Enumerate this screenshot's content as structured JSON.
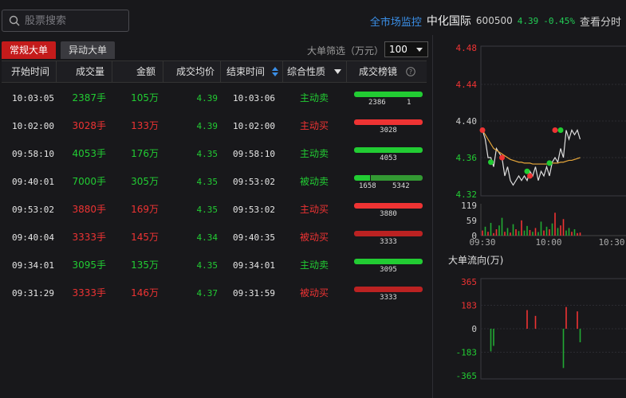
{
  "search": {
    "placeholder": "股票搜索"
  },
  "header": {
    "market_monitor": "全市场监控",
    "stock_name": "中化国际",
    "stock_code": "600500",
    "price": "4.39",
    "change": "-0.45%",
    "timeframe": "查看分时"
  },
  "tabs": [
    {
      "label": "常规大单",
      "active": true
    },
    {
      "label": "异动大单",
      "active": false
    }
  ],
  "filter": {
    "label": "大单筛选（万元）",
    "value": "100"
  },
  "table": {
    "columns": [
      "开始时间",
      "成交量",
      "金额",
      "成交均价",
      "结束时间",
      "综合性质",
      "成交榜镜"
    ],
    "rows": [
      {
        "start": "10:03:05",
        "volume": "2387手",
        "amount": "105万",
        "avg": "4.39",
        "end": "10:03:06",
        "nature": "主动卖",
        "color": "green",
        "bar": [
          {
            "v": "2386",
            "c": "#22cc33"
          },
          {
            "v": "1",
            "c": "#8a9a8a"
          }
        ]
      },
      {
        "start": "10:02:00",
        "volume": "3028手",
        "amount": "133万",
        "avg": "4.39",
        "end": "10:02:00",
        "nature": "主动买",
        "color": "red",
        "bar": [
          {
            "v": "3028",
            "c": "#ee3333"
          }
        ]
      },
      {
        "start": "09:58:10",
        "volume": "4053手",
        "amount": "176万",
        "avg": "4.35",
        "end": "09:58:10",
        "nature": "主动卖",
        "color": "green",
        "bar": [
          {
            "v": "4053",
            "c": "#22cc33"
          }
        ]
      },
      {
        "start": "09:40:01",
        "volume": "7000手",
        "amount": "305万",
        "avg": "4.35",
        "end": "09:53:02",
        "nature": "被动卖",
        "color": "green",
        "bar": [
          {
            "v": "1658",
            "c": "#22cc33"
          },
          {
            "v": "5342",
            "c": "#339933"
          }
        ]
      },
      {
        "start": "09:53:02",
        "volume": "3880手",
        "amount": "169万",
        "avg": "4.35",
        "end": "09:53:02",
        "nature": "主动买",
        "color": "red",
        "bar": [
          {
            "v": "3880",
            "c": "#ee3333"
          }
        ]
      },
      {
        "start": "09:40:04",
        "volume": "3333手",
        "amount": "145万",
        "avg": "4.34",
        "end": "09:40:35",
        "nature": "被动买",
        "color": "red",
        "bar": [
          {
            "v": "3333",
            "c": "#bb2222"
          }
        ]
      },
      {
        "start": "09:34:01",
        "volume": "3095手",
        "amount": "135万",
        "avg": "4.35",
        "end": "09:34:01",
        "nature": "主动卖",
        "color": "green",
        "bar": [
          {
            "v": "3095",
            "c": "#22cc33"
          }
        ]
      },
      {
        "start": "09:31:29",
        "volume": "3333手",
        "amount": "146万",
        "avg": "4.37",
        "end": "09:31:59",
        "nature": "被动买",
        "color": "red",
        "bar": [
          {
            "v": "3333",
            "c": "#bb2222"
          }
        ]
      }
    ]
  },
  "chart_data": [
    {
      "type": "line",
      "title": "",
      "y_ticks": [
        "4.48",
        "4.44",
        "4.40",
        "4.36",
        "4.32"
      ],
      "ylim": [
        4.32,
        4.48
      ],
      "x": [
        0,
        1,
        2,
        3,
        4,
        5,
        6,
        7,
        8,
        9,
        10,
        11,
        12,
        13,
        14,
        15,
        16,
        17,
        18,
        19,
        20,
        21,
        22,
        23,
        24,
        25,
        26,
        27,
        28,
        29,
        30,
        31,
        32,
        33,
        34,
        35
      ],
      "series": [
        {
          "color": "#e0e0e0",
          "values": [
            4.39,
            4.38,
            4.36,
            4.36,
            4.35,
            4.37,
            4.365,
            4.36,
            4.34,
            4.35,
            4.335,
            4.33,
            4.335,
            4.34,
            4.335,
            4.34,
            4.335,
            4.345,
            4.34,
            4.35,
            4.335,
            4.345,
            4.34,
            4.35,
            4.34,
            4.355,
            4.36,
            4.355,
            4.37,
            4.36,
            4.39,
            4.38,
            4.39,
            4.385,
            4.39,
            4.38
          ]
        },
        {
          "color": "#e6a63a",
          "values": [
            4.39,
            4.385,
            4.38,
            4.375,
            4.37,
            4.368,
            4.366,
            4.364,
            4.362,
            4.36,
            4.358,
            4.357,
            4.356,
            4.355,
            4.355,
            4.354,
            4.354,
            4.354,
            4.353,
            4.353,
            4.353,
            4.353,
            4.353,
            4.353,
            4.353,
            4.354,
            4.354,
            4.354,
            4.355,
            4.355,
            4.356,
            4.357,
            4.357,
            4.358,
            4.359,
            4.36
          ]
        }
      ],
      "markers": [
        {
          "x": 0,
          "y": 4.39,
          "c": "#ee3333"
        },
        {
          "x": 3,
          "y": 4.355,
          "c": "#22cc33"
        },
        {
          "x": 7,
          "y": 4.36,
          "c": "#ee3333"
        },
        {
          "x": 16,
          "y": 4.345,
          "c": "#22cc33"
        },
        {
          "x": 17,
          "y": 4.34,
          "c": "#ee3333"
        },
        {
          "x": 24,
          "y": 4.354,
          "c": "#22cc33"
        },
        {
          "x": 26,
          "y": 4.39,
          "c": "#ee3333"
        },
        {
          "x": 28,
          "y": 4.39,
          "c": "#22cc33"
        }
      ]
    },
    {
      "type": "bar",
      "title": "",
      "y_ticks": [
        "119",
        "59",
        "0"
      ],
      "x_ticks": [
        "09:30",
        "10:00",
        "10:30"
      ],
      "ylim": [
        0,
        119
      ],
      "values": [
        20,
        35,
        15,
        50,
        10,
        25,
        40,
        70,
        15,
        30,
        12,
        45,
        25,
        18,
        60,
        20,
        38,
        22,
        15,
        30,
        14,
        55,
        20,
        35,
        25,
        48,
        90,
        30,
        40,
        65,
        20,
        30,
        15,
        25,
        10,
        12
      ],
      "colors": [
        "r",
        "g",
        "r",
        "g",
        "r",
        "r",
        "g",
        "g",
        "r",
        "g",
        "r",
        "g",
        "r",
        "g",
        "r",
        "g",
        "g",
        "r",
        "g",
        "r",
        "g",
        "g",
        "r",
        "g",
        "r",
        "g",
        "r",
        "g",
        "r",
        "r",
        "g",
        "g",
        "r",
        "g",
        "r",
        "r"
      ]
    },
    {
      "type": "bar",
      "title": "大单流向(万)",
      "y_ticks": [
        "365",
        "183",
        "0",
        "-183",
        "-365"
      ],
      "ylim": [
        -365,
        365
      ],
      "values": [
        0,
        0,
        0,
        -176,
        -133,
        0,
        0,
        0,
        0,
        0,
        0,
        0,
        0,
        0,
        0,
        0,
        145,
        0,
        0,
        100,
        0,
        0,
        0,
        0,
        0,
        0,
        0,
        0,
        0,
        -305,
        169,
        0,
        0,
        0,
        135,
        -105
      ]
    }
  ]
}
